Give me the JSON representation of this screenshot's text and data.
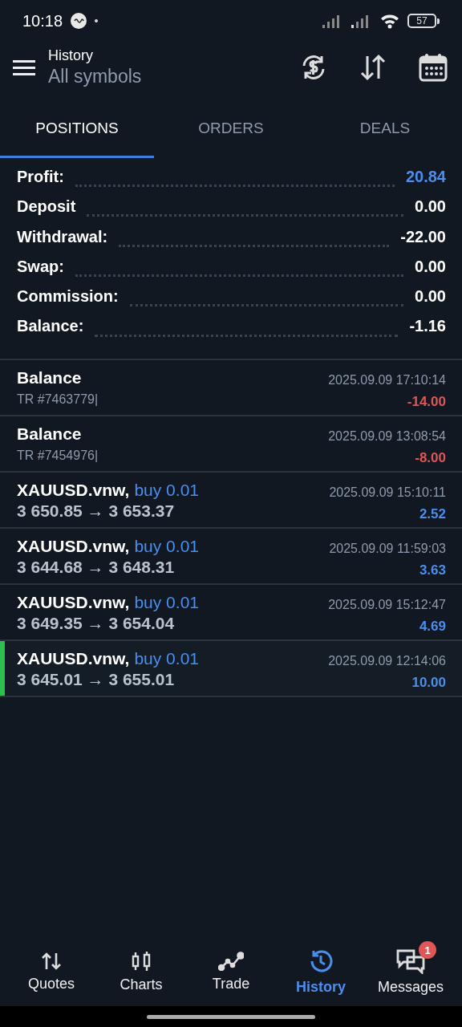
{
  "status_bar": {
    "time": "10:18",
    "battery": "57"
  },
  "header": {
    "title": "History",
    "subtitle": "All symbols"
  },
  "tabs": [
    {
      "label": "POSITIONS",
      "selected": true
    },
    {
      "label": "ORDERS",
      "selected": false
    },
    {
      "label": "DEALS",
      "selected": false
    }
  ],
  "summary": [
    {
      "label": "Profit:",
      "value": "20.84",
      "kind": "profit"
    },
    {
      "label": "Deposit",
      "value": "0.00",
      "kind": "plain"
    },
    {
      "label": "Withdrawal:",
      "value": "-22.00",
      "kind": "plain"
    },
    {
      "label": "Swap:",
      "value": "0.00",
      "kind": "plain"
    },
    {
      "label": "Commission:",
      "value": "0.00",
      "kind": "plain"
    },
    {
      "label": "Balance:",
      "value": "-1.16",
      "kind": "plain"
    }
  ],
  "deals": [
    {
      "kind": "balance",
      "title": "Balance",
      "comment": "TR #7463779|",
      "time": "2025.09.09 17:10:14",
      "amount": "-14.00",
      "color": "#e05555",
      "selected": false
    },
    {
      "kind": "balance",
      "title": "Balance",
      "comment": "TR #7454976|",
      "time": "2025.09.09 13:08:54",
      "amount": "-8.00",
      "color": "#e05555",
      "selected": false
    },
    {
      "kind": "trade",
      "symbol": "XAUUSD.vnw,",
      "action": "buy 0.01",
      "prices": "3 650.85 → 3 653.37",
      "time": "2025.09.09 15:10:11",
      "amount": "2.52",
      "color": "#4a8ef0",
      "selected": false
    },
    {
      "kind": "trade",
      "symbol": "XAUUSD.vnw,",
      "action": "buy 0.01",
      "prices": "3 644.68 → 3 648.31",
      "time": "2025.09.09 11:59:03",
      "amount": "3.63",
      "color": "#4a8ef0",
      "selected": false
    },
    {
      "kind": "trade",
      "symbol": "XAUUSD.vnw,",
      "action": "buy 0.01",
      "prices": "3 649.35 → 3 654.04",
      "time": "2025.09.09 15:12:47",
      "amount": "4.69",
      "color": "#4a8ef0",
      "selected": false
    },
    {
      "kind": "trade",
      "symbol": "XAUUSD.vnw,",
      "action": "buy 0.01",
      "prices": "3 645.01 → 3 655.01",
      "time": "2025.09.09 12:14:06",
      "amount": "10.00",
      "color": "#4a8ef0",
      "selected": true
    }
  ],
  "bottom_nav": [
    {
      "label": "Quotes",
      "selected": false
    },
    {
      "label": "Charts",
      "selected": false
    },
    {
      "label": "Trade",
      "selected": false
    },
    {
      "label": "History",
      "selected": true
    },
    {
      "label": "Messages",
      "selected": false,
      "badge": "1"
    }
  ]
}
